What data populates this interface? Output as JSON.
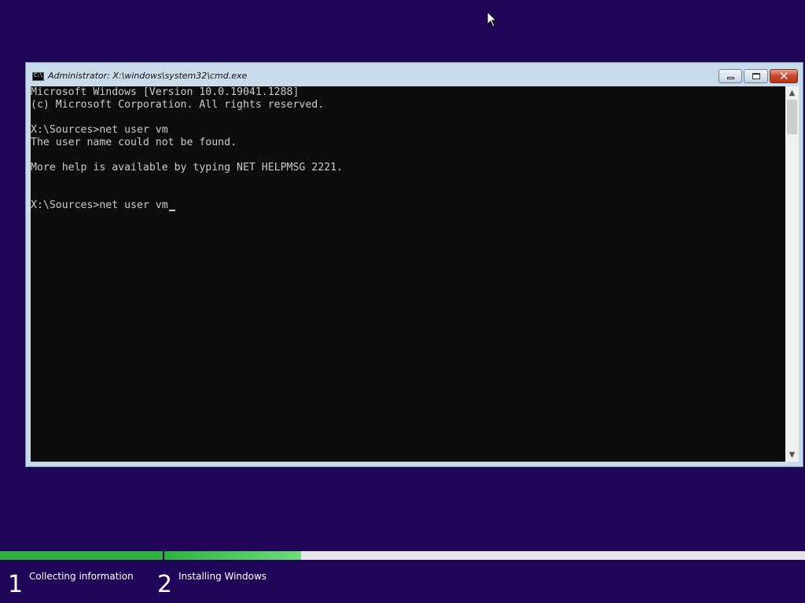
{
  "window": {
    "title": "Administrator: X:\\windows\\system32\\cmd.exe",
    "icon_label": "C:\\",
    "buttons": {
      "minimize": "minimize-icon",
      "maximize": "maximize-icon",
      "close": "close-icon",
      "close_glyph": "✕"
    }
  },
  "console": {
    "lines": [
      "Microsoft Windows [Version 10.0.19041.1288]",
      "(c) Microsoft Corporation. All rights reserved.",
      "",
      "X:\\Sources>net user vm",
      "The user name could not be found.",
      "",
      "More help is available by typing NET HELPMSG 2221.",
      "",
      "",
      "X:\\Sources>net user vm"
    ]
  },
  "scrollbar": {
    "up_arrow": "▲",
    "down_arrow": "▼"
  },
  "setup_progress": {
    "steps": [
      {
        "number": "1",
        "label": "Collecting information",
        "progress": 1.0
      },
      {
        "number": "2",
        "label": "Installing Windows",
        "progress": 0.21
      }
    ]
  },
  "colors": {
    "desktop_background": "#200558",
    "progress_green": "#2fb240",
    "console_background": "#0c0c0c",
    "console_text": "#cccccc"
  }
}
